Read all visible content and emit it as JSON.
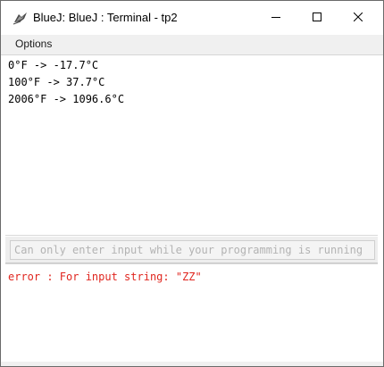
{
  "window": {
    "title": "BlueJ: BlueJ : Terminal - tp2",
    "icon": "bluej-bird-icon",
    "controls": [
      "minimize",
      "maximize",
      "close"
    ]
  },
  "menubar": {
    "items": [
      {
        "label": "Options"
      }
    ]
  },
  "terminal": {
    "output_lines": [
      "0°F -> -17.7°C",
      "100°F -> 37.7°C",
      "2006°F -> 1096.6°C"
    ],
    "input": {
      "value": "",
      "placeholder": "Can only enter input while your programming is running"
    },
    "errors": [
      "error : For input string: \"ZZ\""
    ]
  },
  "colors": {
    "error_text": "#e0261f",
    "input_placeholder": "#b3b3b3",
    "menubar_bg": "#f0f0f0"
  }
}
